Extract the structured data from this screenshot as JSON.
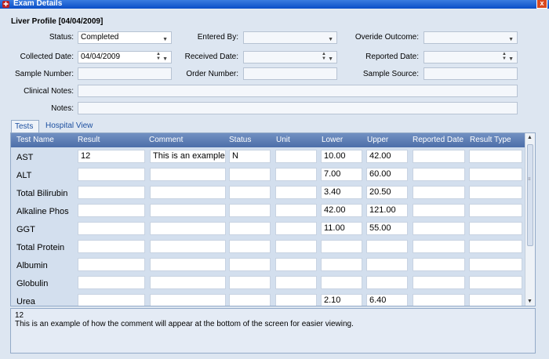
{
  "window": {
    "title": "Exam Details",
    "close_glyph": "x"
  },
  "profile": {
    "title": "Liver Profile [04/04/2009]",
    "status_label": "Status:",
    "status_value": "Completed",
    "entered_by_label": "Entered By:",
    "entered_by_value": "",
    "override_label": "Overide Outcome:",
    "override_value": "",
    "collected_label": "Collected Date:",
    "collected_value": "04/04/2009",
    "received_label": "Received Date:",
    "received_value": "",
    "reported_label": "Reported Date:",
    "reported_value": "",
    "sample_number_label": "Sample Number:",
    "sample_number_value": "",
    "order_number_label": "Order Number:",
    "order_number_value": "",
    "sample_source_label": "Sample Source:",
    "sample_source_value": "",
    "clinical_notes_label": "Clinical Notes:",
    "clinical_notes_value": "",
    "notes_label": "Notes:",
    "notes_value": ""
  },
  "tabs": [
    "Tests",
    "Hospital View"
  ],
  "grid": {
    "columns": [
      "Test Name",
      "Result",
      "Comment",
      "Status",
      "Unit",
      "Lower",
      "Upper",
      "Reported Date",
      "Result Type"
    ],
    "rows": [
      {
        "name": "AST",
        "result": "12",
        "comment": "This is an example",
        "status": "N",
        "unit": "",
        "lower": "10.00",
        "upper": "42.00",
        "reported": "",
        "type": ""
      },
      {
        "name": "ALT",
        "result": "",
        "comment": "",
        "status": "",
        "unit": "",
        "lower": "7.00",
        "upper": "60.00",
        "reported": "",
        "type": ""
      },
      {
        "name": "Total Bilirubin",
        "result": "",
        "comment": "",
        "status": "",
        "unit": "",
        "lower": "3.40",
        "upper": "20.50",
        "reported": "",
        "type": ""
      },
      {
        "name": "Alkaline Phos",
        "result": "",
        "comment": "",
        "status": "",
        "unit": "",
        "lower": "42.00",
        "upper": "121.00",
        "reported": "",
        "type": ""
      },
      {
        "name": "GGT",
        "result": "",
        "comment": "",
        "status": "",
        "unit": "",
        "lower": "11.00",
        "upper": "55.00",
        "reported": "",
        "type": ""
      },
      {
        "name": "Total Protein",
        "result": "",
        "comment": "",
        "status": "",
        "unit": "",
        "lower": "",
        "upper": "",
        "reported": "",
        "type": ""
      },
      {
        "name": "Albumin",
        "result": "",
        "comment": "",
        "status": "",
        "unit": "",
        "lower": "",
        "upper": "",
        "reported": "",
        "type": ""
      },
      {
        "name": "Globulin",
        "result": "",
        "comment": "",
        "status": "",
        "unit": "",
        "lower": "",
        "upper": "",
        "reported": "",
        "type": ""
      },
      {
        "name": "Urea",
        "result": "",
        "comment": "",
        "status": "",
        "unit": "",
        "lower": "2.10",
        "upper": "6.40",
        "reported": "",
        "type": ""
      }
    ]
  },
  "comment_panel": {
    "line1": "12",
    "line2": "This is an example of how the comment will appear at the bottom of the screen for easier viewing."
  }
}
